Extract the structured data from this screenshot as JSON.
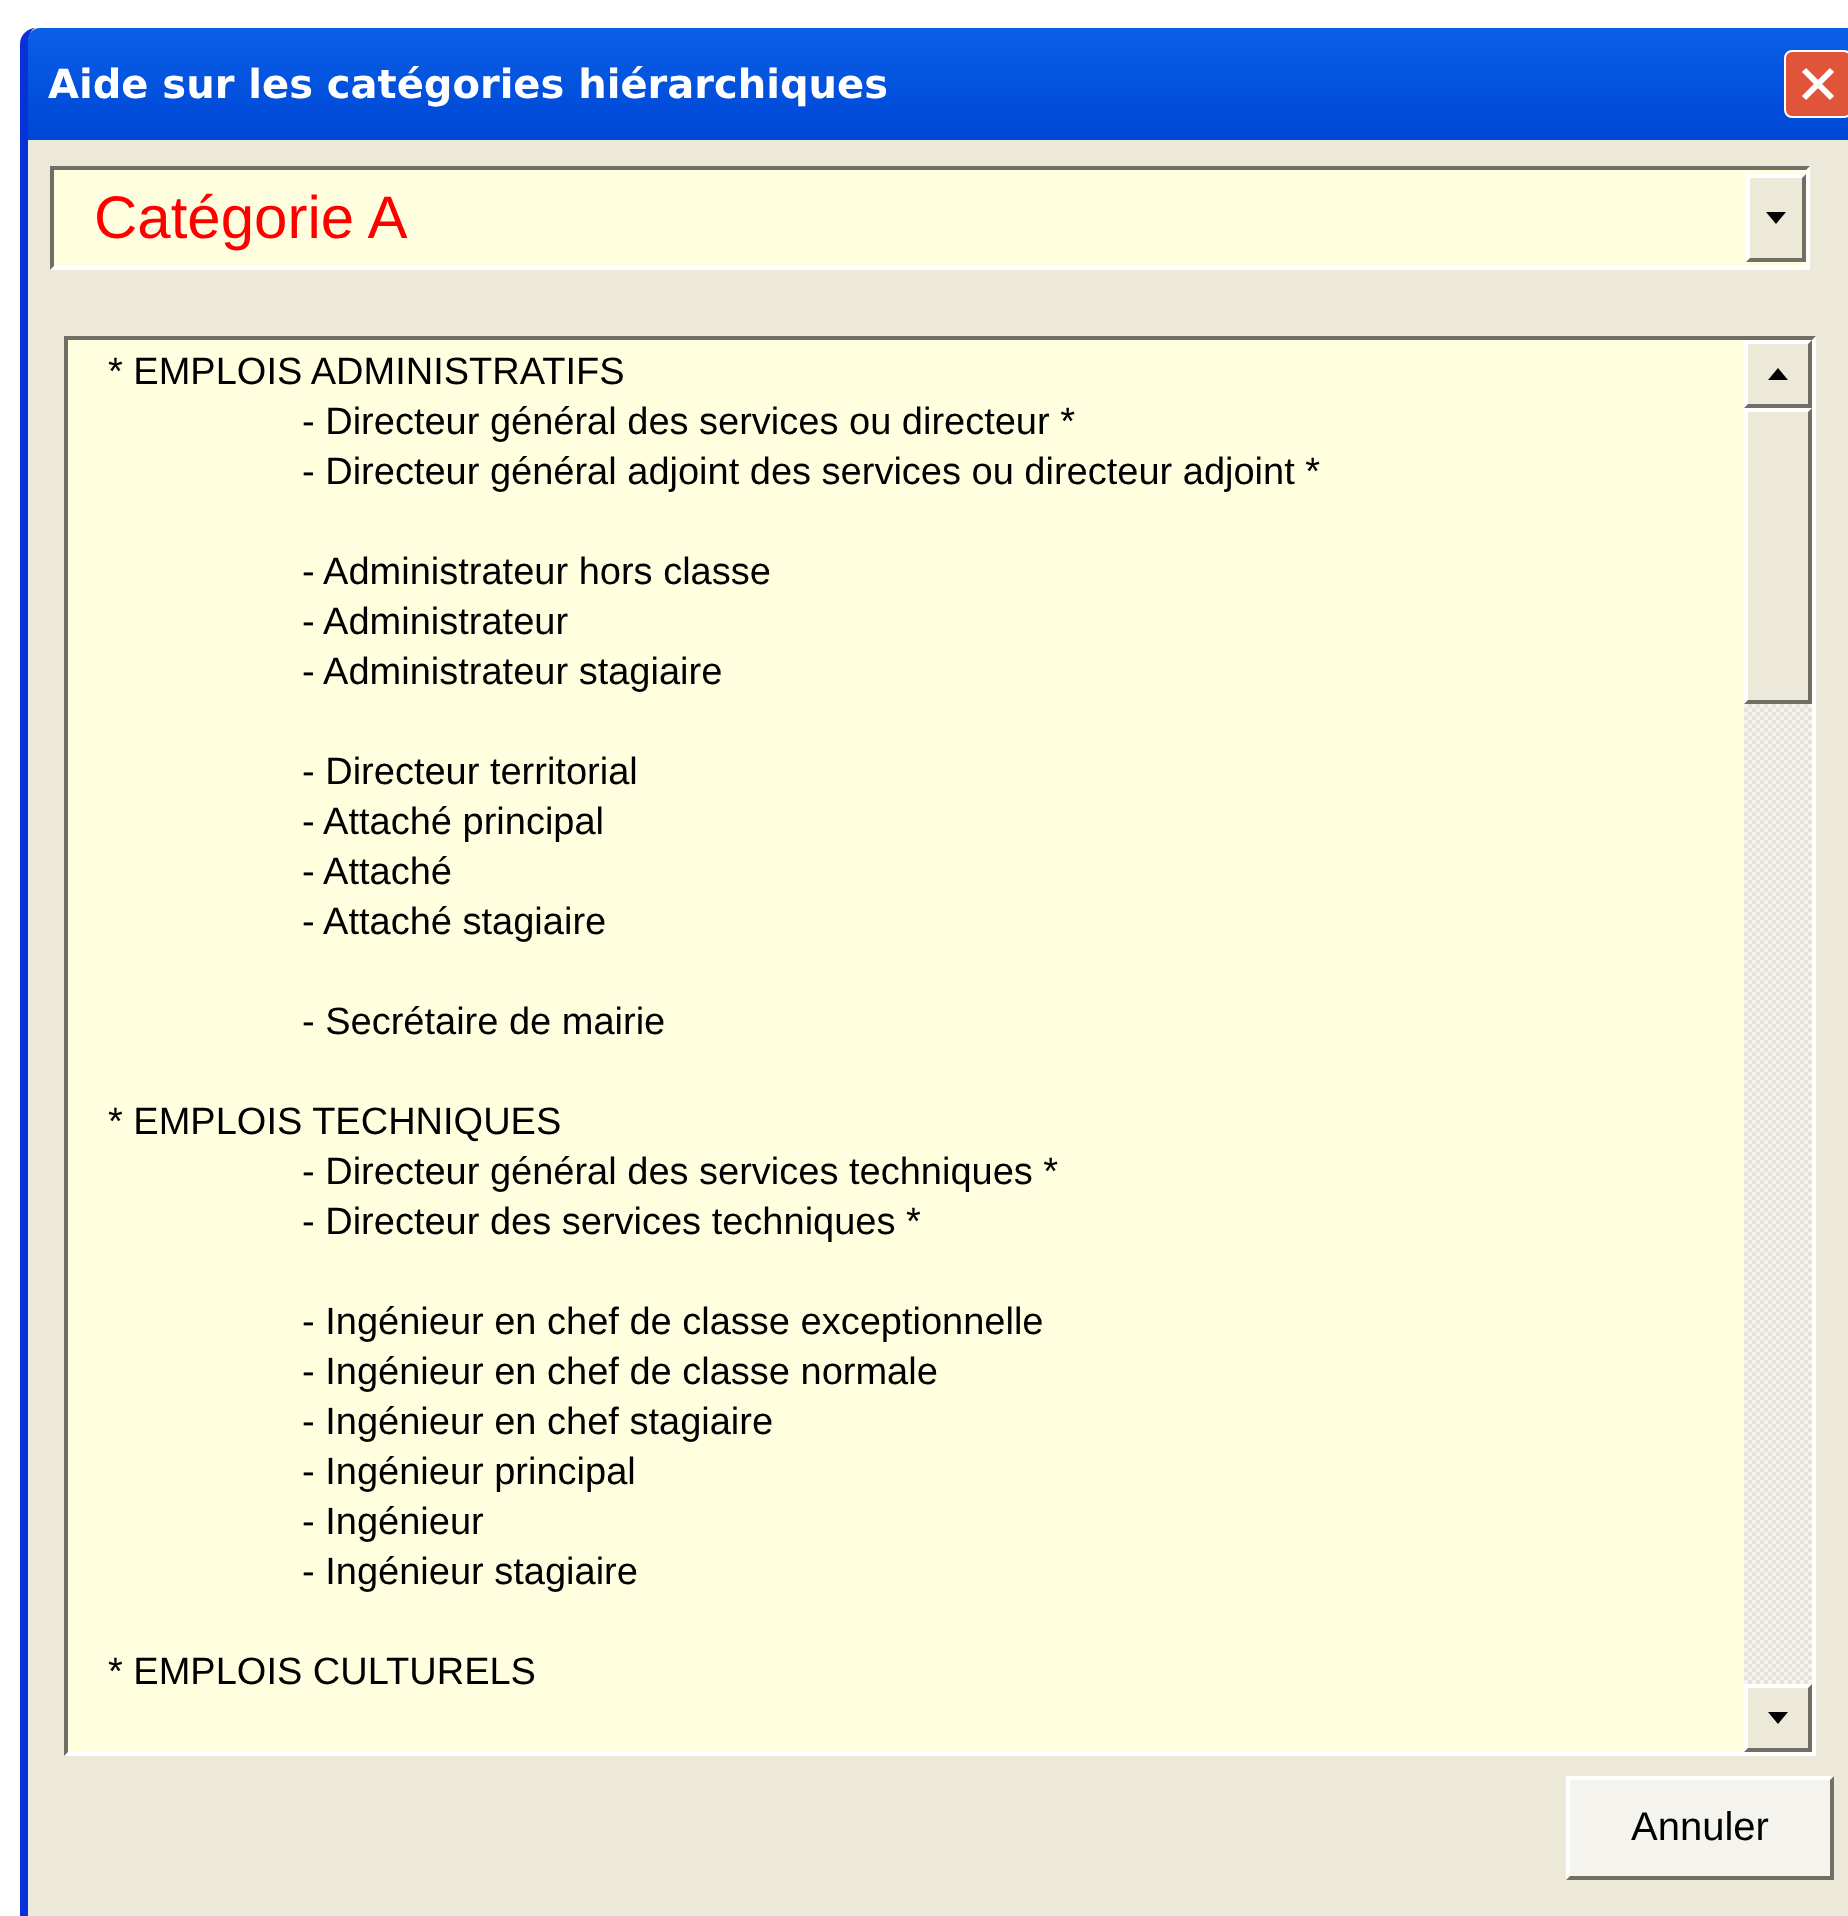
{
  "window": {
    "title": "Aide sur les catégories hiérarchiques"
  },
  "category_select": {
    "value": "Catégorie A"
  },
  "sections": [
    {
      "heading": "* EMPLOIS ADMINISTRATIFS",
      "groups": [
        [
          "- Directeur général des services ou directeur *",
          "- Directeur général adjoint des services ou directeur adjoint *"
        ],
        [
          "- Administrateur hors classe",
          "- Administrateur",
          "- Administrateur stagiaire"
        ],
        [
          "- Directeur territorial",
          "- Attaché principal",
          "- Attaché",
          "- Attaché stagiaire"
        ],
        [
          "- Secrétaire de mairie"
        ]
      ]
    },
    {
      "heading": "* EMPLOIS TECHNIQUES",
      "groups": [
        [
          "- Directeur général des services techniques *",
          "- Directeur des services techniques *"
        ],
        [
          "- Ingénieur en chef de classe exceptionnelle",
          "- Ingénieur en chef de classe normale",
          "- Ingénieur en chef stagiaire",
          "- Ingénieur principal",
          "- Ingénieur",
          "- Ingénieur stagiaire"
        ]
      ]
    },
    {
      "heading": "* EMPLOIS CULTURELS"
    }
  ],
  "buttons": [
    "Annuler"
  ]
}
